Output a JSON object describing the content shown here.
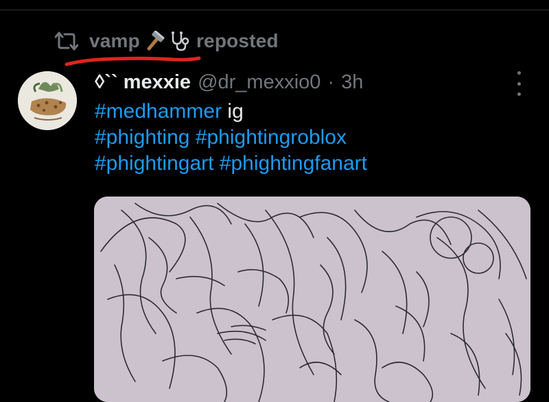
{
  "repost": {
    "reposter_name": "vamp",
    "emoji_1": "hammer-icon",
    "emoji_2": "stethoscope-icon",
    "label": "reposted",
    "underline_color": "#e0241b"
  },
  "post": {
    "author": {
      "display_name": "◊`` mexxie",
      "handle": "@dr_mexxio0",
      "separator": "·",
      "timestamp": "3h"
    },
    "lines": [
      {
        "tag": "#medhammer",
        "text": " ig"
      },
      {
        "tags": [
          "#phighting",
          "#phightingroblox"
        ]
      },
      {
        "tags": [
          "#phightingart",
          "#phightingfanart"
        ]
      }
    ],
    "media": {
      "icon": "sketch-artwork-image",
      "background": "#cbc2cd"
    }
  },
  "colors": {
    "background": "#000000",
    "primary_text": "#e7e9ea",
    "secondary_text": "#71767b",
    "link": "#1d9bf0"
  }
}
